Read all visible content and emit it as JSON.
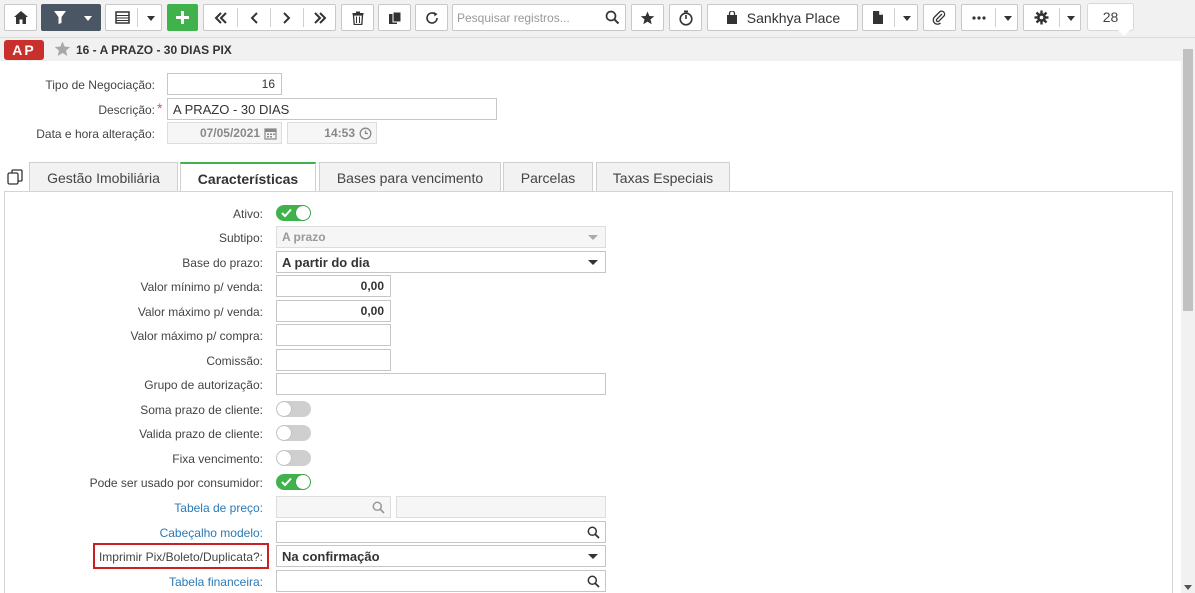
{
  "toolbar": {
    "search_placeholder": "Pesquisar registros...",
    "place_label": "Sankhya Place",
    "record_count": "28"
  },
  "header": {
    "badge": "AP",
    "title": "16 - A PRAZO - 30 DIAS PIX"
  },
  "form": {
    "tipo_label": "Tipo de Negociação:",
    "tipo_value": "16",
    "descricao_label": "Descrição:",
    "descricao_value": "A PRAZO - 30 DIAS",
    "data_label": "Data e hora alteração:",
    "data_value": "07/05/2021",
    "hora_value": "14:53"
  },
  "tabs": [
    {
      "label": "Gestão Imobiliária"
    },
    {
      "label": "Características"
    },
    {
      "label": "Bases para vencimento"
    },
    {
      "label": "Parcelas"
    },
    {
      "label": "Taxas Especiais"
    }
  ],
  "fields": {
    "ativo_label": "Ativo:",
    "subtipo_label": "Subtipo:",
    "subtipo_value": "A prazo",
    "base_label": "Base do prazo:",
    "base_value": "A partir do dia",
    "vmin_label": "Valor mínimo p/ venda:",
    "vmin_value": "0,00",
    "vmax_label": "Valor máximo p/ venda:",
    "vmax_value": "0,00",
    "vmaxc_label": "Valor máximo p/ compra:",
    "comissao_label": "Comissão:",
    "grupo_label": "Grupo de autorização:",
    "soma_label": "Soma prazo de cliente:",
    "valida_label": "Valida prazo de cliente:",
    "fixa_label": "Fixa vencimento:",
    "consumidor_label": "Pode ser usado por consumidor:",
    "tabpreco_label": "Tabela de preço:",
    "cabecalho_label": "Cabeçalho modelo:",
    "imprimir_label": "Imprimir Pix/Boleto/Duplicata?:",
    "imprimir_value": "Na confirmação",
    "tabfin_label": "Tabela financeira:"
  },
  "toggles": {
    "ativo": true,
    "soma": false,
    "valida": false,
    "fixa": false,
    "consumidor": true
  }
}
